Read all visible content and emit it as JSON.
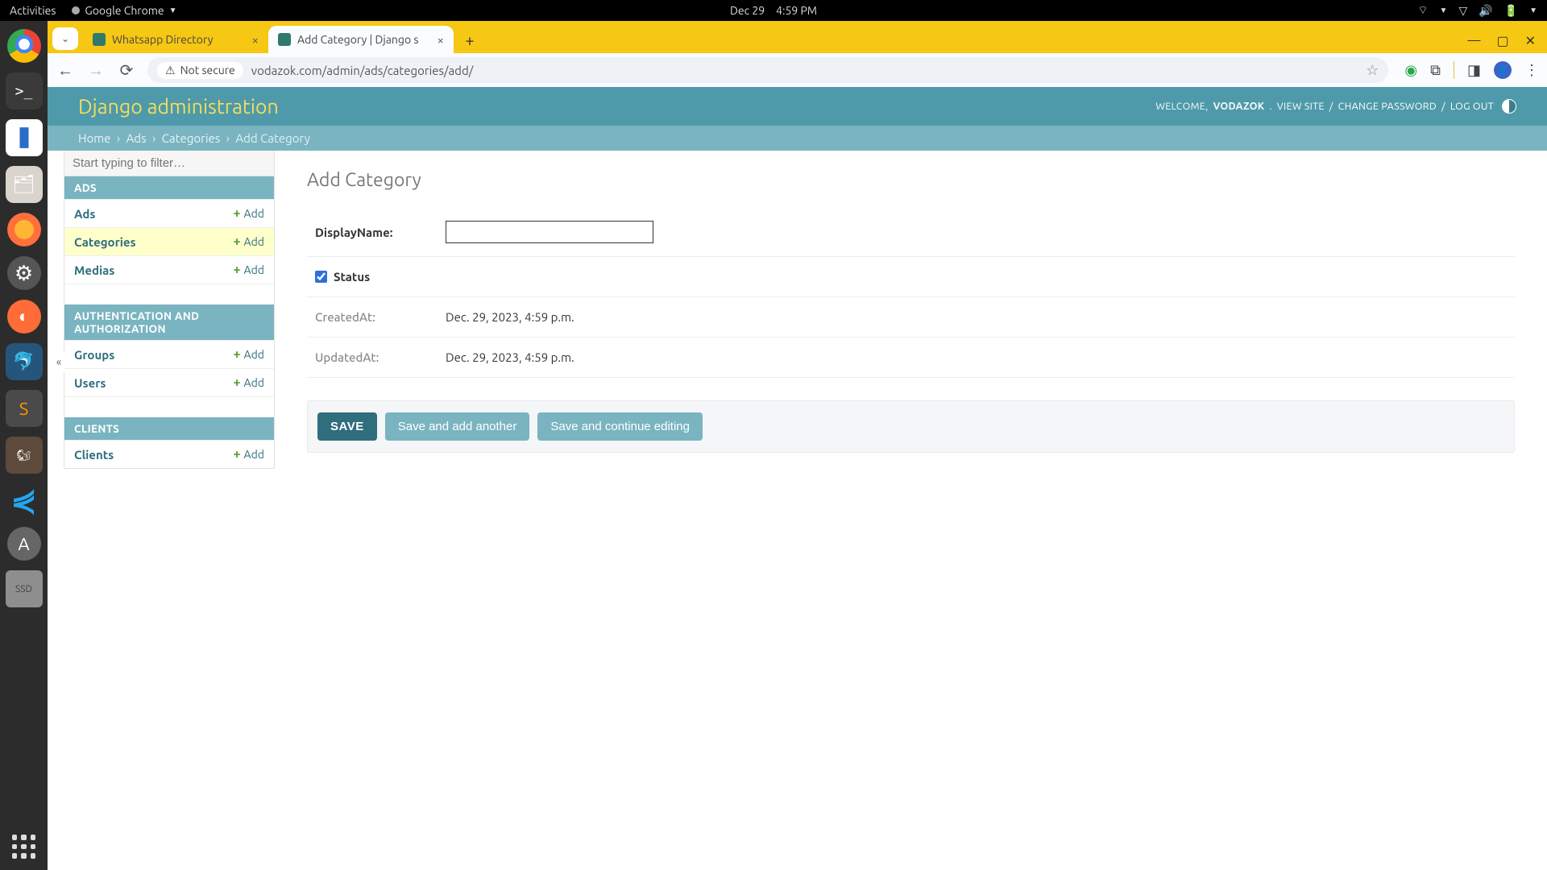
{
  "gnome": {
    "activities": "Activities",
    "app": "Google Chrome",
    "date": "Dec 29",
    "time": "4:59 PM"
  },
  "tabs": {
    "t1": "Whatsapp Directory",
    "t2": "Add Category | Django s"
  },
  "omnibox": {
    "secure": "Not secure",
    "url": "vodazok.com/admin/ads/categories/add/"
  },
  "header": {
    "brand": "Django administration",
    "welcome": "WELCOME, ",
    "username": "VODAZOK",
    "viewsite": "VIEW SITE",
    "changepw": "CHANGE PASSWORD",
    "logout": "LOG OUT"
  },
  "breadcrumbs": {
    "home": "Home",
    "ads": "Ads",
    "categories": "Categories",
    "current": "Add Category"
  },
  "sidebar": {
    "filter_placeholder": "Start typing to filter…",
    "ads": "ADS",
    "auth": "AUTHENTICATION AND AUTHORIZATION",
    "clients": "CLIENTS",
    "add": "Add",
    "models": {
      "ads": "Ads",
      "categories": "Categories",
      "medias": "Medias",
      "groups": "Groups",
      "users": "Users",
      "clients": "Clients"
    },
    "collapse": "«"
  },
  "form": {
    "title": "Add Category",
    "displayname_label": "DisplayName:",
    "displayname_value": "",
    "status_label": "Status",
    "createdat_label": "CreatedAt:",
    "createdat_value": "Dec. 29, 2023, 4:59 p.m.",
    "updatedat_label": "UpdatedAt:",
    "updatedat_value": "Dec. 29, 2023, 4:59 p.m.",
    "save": "SAVE",
    "save_add": "Save and add another",
    "save_cont": "Save and continue editing"
  }
}
